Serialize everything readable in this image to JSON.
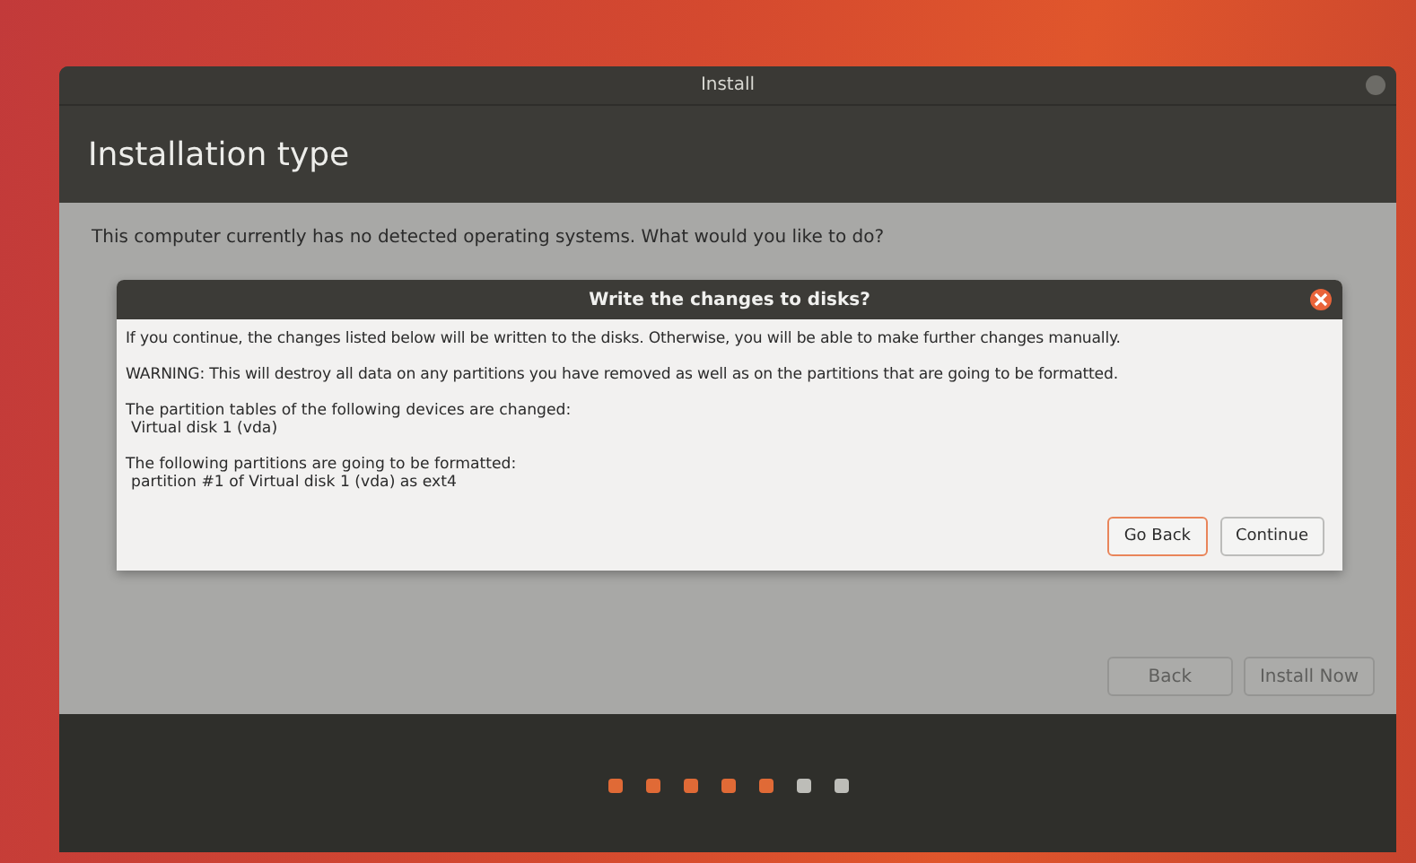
{
  "window": {
    "title": "Install"
  },
  "header": {
    "title": "Installation type"
  },
  "content": {
    "question": "This computer currently has no detected operating systems. What would you like to do?"
  },
  "dialog": {
    "title": "Write the changes to disks?",
    "paragraphs": [
      "If you continue, the changes listed below will be written to the disks. Otherwise, you will be able to make further changes manually.",
      "WARNING: This will destroy all data on any partitions you have removed as well as on the partitions that are going to be formatted."
    ],
    "sections": [
      {
        "heading": "The partition tables of the following devices are changed:",
        "detail": "Virtual disk 1 (vda)"
      },
      {
        "heading": "The following partitions are going to be formatted:",
        "detail": "partition #1 of Virtual disk 1 (vda) as ext4"
      }
    ],
    "buttons": [
      {
        "label": "Go Back",
        "selected": true
      },
      {
        "label": "Continue",
        "selected": false
      }
    ]
  },
  "buttons": [
    {
      "label": "Back",
      "disabled": true
    },
    {
      "label": "Install Now",
      "disabled": true
    }
  ],
  "steps": [
    {
      "done": true
    },
    {
      "done": true
    },
    {
      "done": true
    },
    {
      "done": true
    },
    {
      "done": true
    },
    {
      "done": false
    },
    {
      "done": false
    }
  ]
}
